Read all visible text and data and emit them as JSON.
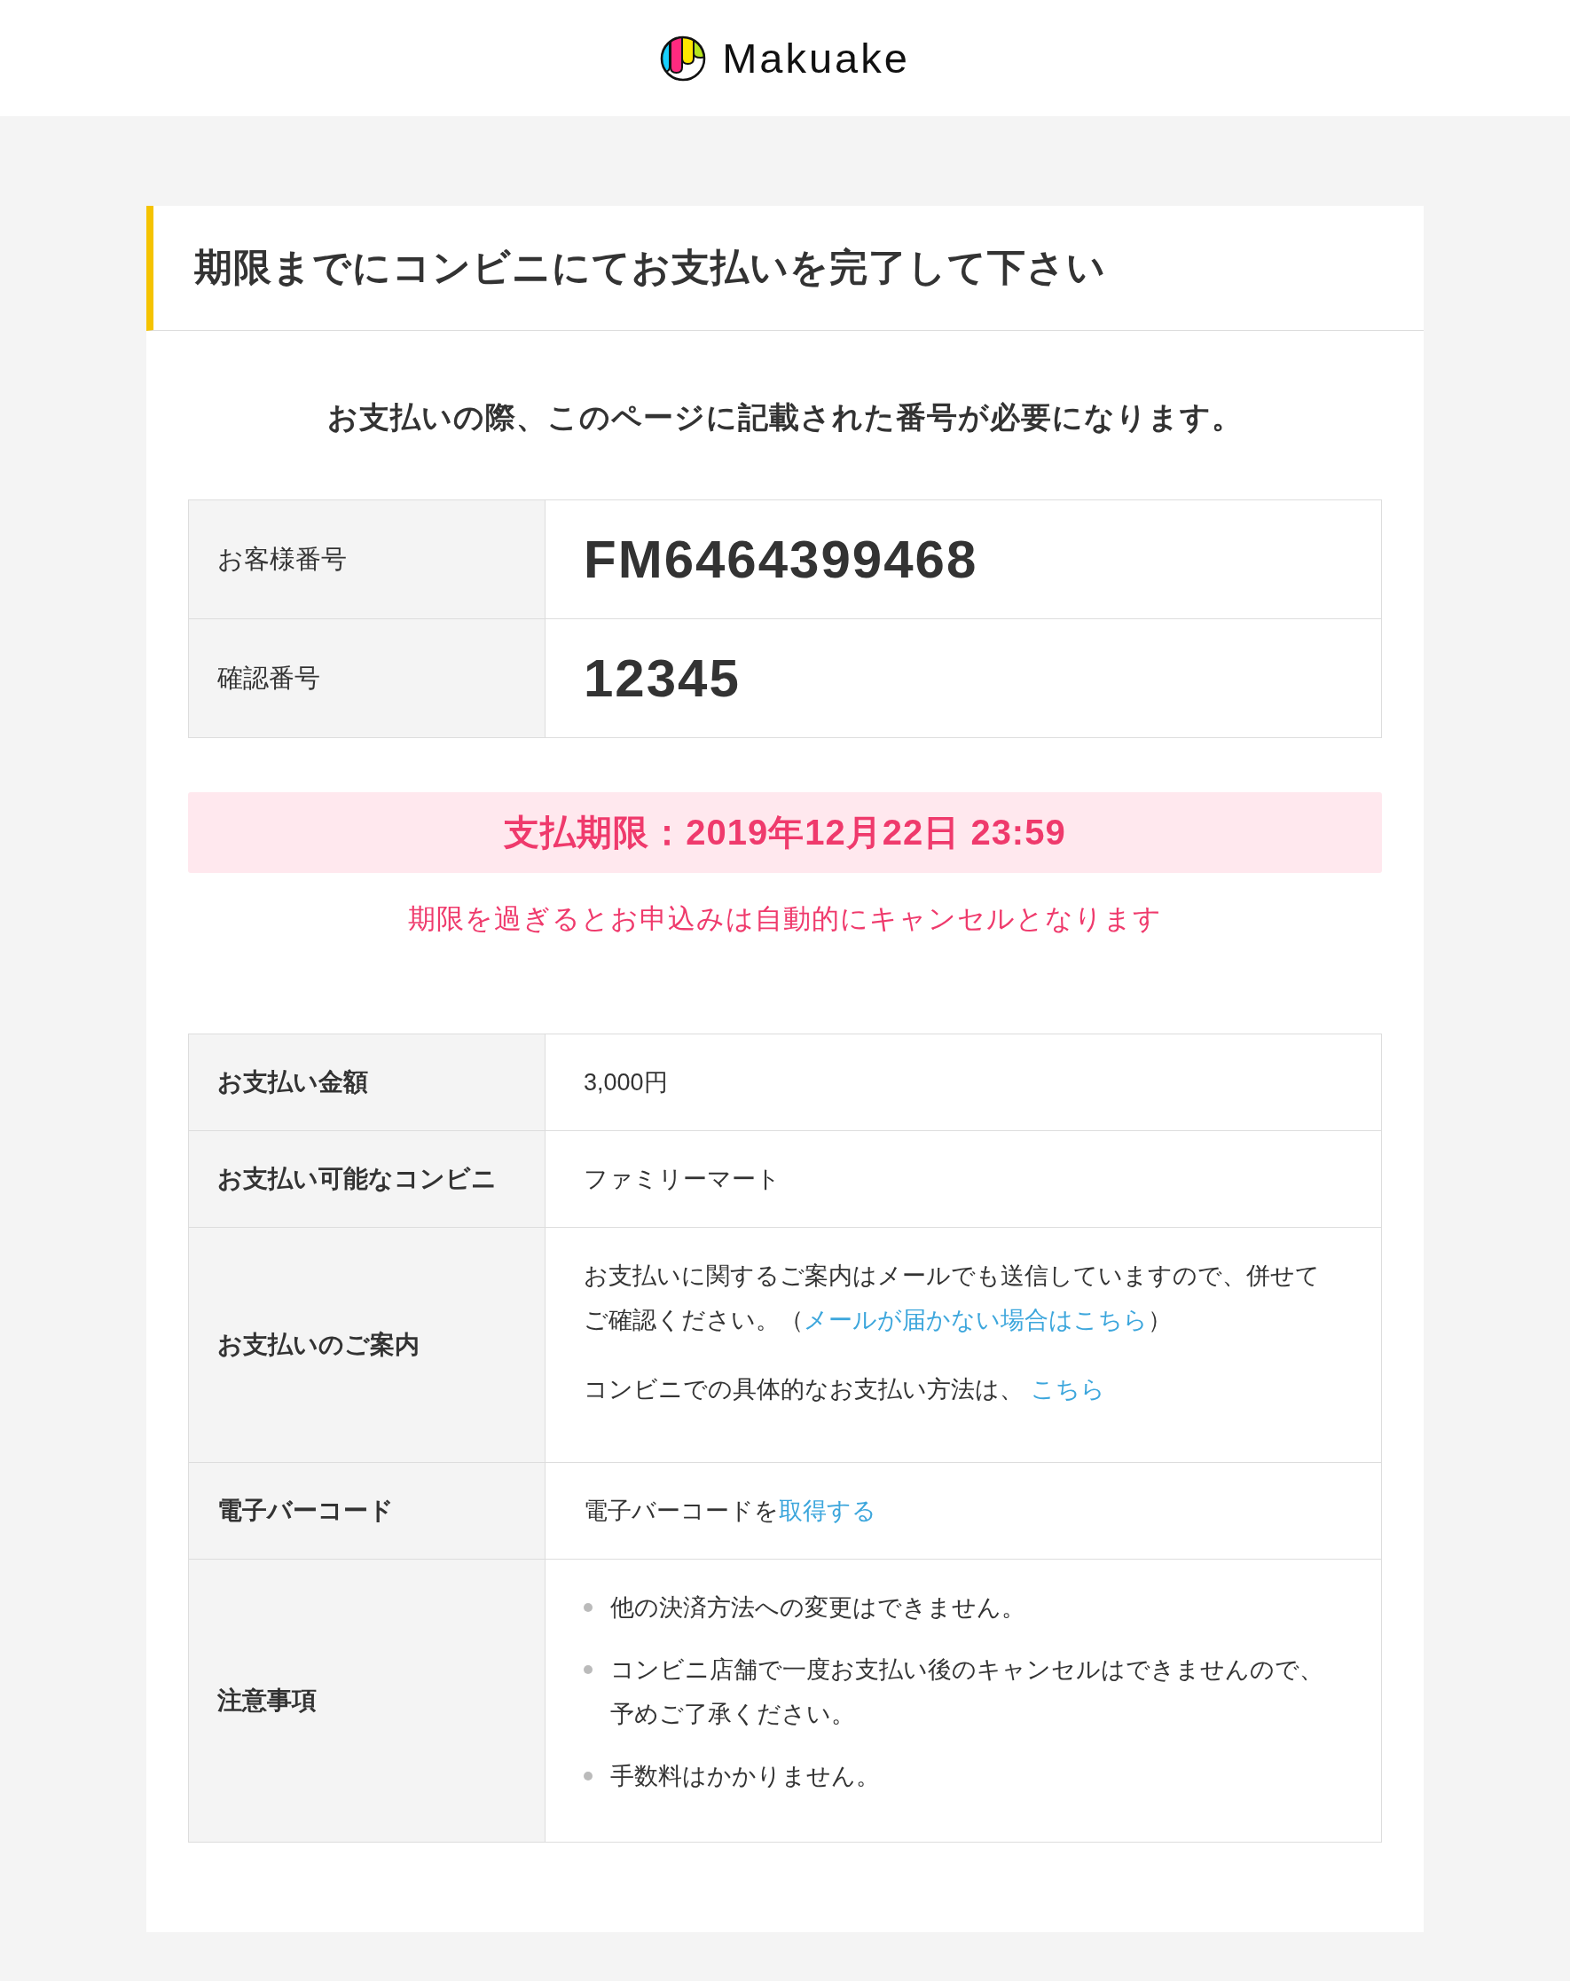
{
  "header": {
    "logo_text": "Makuake"
  },
  "card": {
    "title": "期限までにコンビニにてお支払いを完了して下さい",
    "intro": "お支払いの際、このページに記載された番号が必要になります。",
    "number_table": {
      "rows": [
        {
          "label": "お客様番号",
          "value": "FM6464399468"
        },
        {
          "label": "確認番号",
          "value": "12345"
        }
      ]
    },
    "deadline": {
      "text": "支払期限：2019年12月22日 23:59",
      "note": "期限を過ぎるとお申込みは自動的にキャンセルとなります"
    },
    "details_table": {
      "rows": [
        {
          "kind": "text",
          "label": "お支払い金額",
          "value": "3,000円"
        },
        {
          "kind": "text",
          "label": "お支払い可能なコンビニ",
          "value": "ファミリーマート"
        },
        {
          "kind": "paragraphs",
          "label": "お支払いのご案内",
          "paragraphs": [
            {
              "segments": [
                {
                  "text": "お支払いに関するご案内はメールでも送信していますので、併せてご確認ください。（",
                  "link": false
                },
                {
                  "text": "メールが届かない場合はこちら",
                  "link": true
                },
                {
                  "text": "）",
                  "link": false
                }
              ]
            },
            {
              "segments": [
                {
                  "text": "コンビニでの具体的なお支払い方法は、 ",
                  "link": false
                },
                {
                  "text": "こちら",
                  "link": true
                }
              ]
            }
          ]
        },
        {
          "kind": "rich",
          "label": "電子バーコード",
          "segments": [
            {
              "text": "電子バーコードを",
              "link": false
            },
            {
              "text": "取得する",
              "link": true
            }
          ]
        },
        {
          "kind": "bullets",
          "label": "注意事項",
          "items": [
            "他の決済方法への変更はできません。",
            "コンビニ店舗で一度お支払い後のキャンセルはできませんので、予めご了承ください。",
            "手数料はかかりません。"
          ]
        }
      ]
    }
  }
}
